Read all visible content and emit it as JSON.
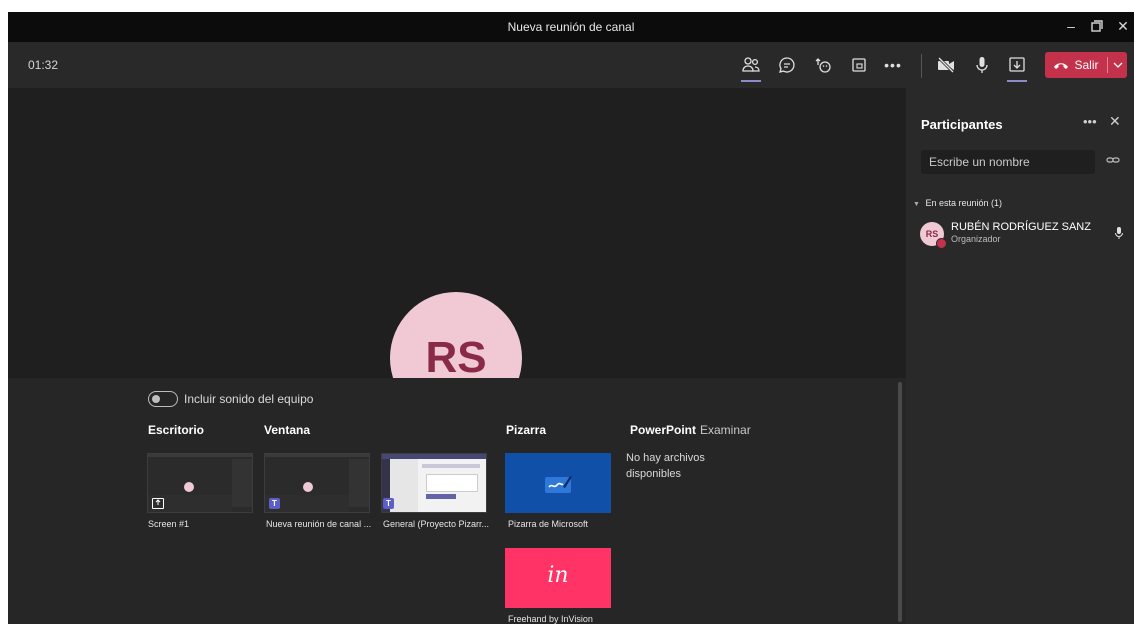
{
  "window": {
    "title": "Nueva reunión de canal"
  },
  "toolbar": {
    "timer": "01:32",
    "leave_label": "Salir"
  },
  "share_tray": {
    "include_sound_label": "Incluir sonido del equipo",
    "headers": {
      "desktop": "Escritorio",
      "window": "Ventana",
      "whiteboard": "Pizarra",
      "powerpoint": "PowerPoint",
      "browse": "Examinar"
    },
    "thumbnails": [
      {
        "label": "Screen #1"
      },
      {
        "label": "Nueva reunión de canal ..."
      },
      {
        "label": "General (Proyecto Pizarr..."
      },
      {
        "label": "Pizarra de Microsoft"
      },
      {
        "label": "Freehand by InVision"
      }
    ],
    "no_files": "No hay archivos disponibles",
    "invision_logo": "in"
  },
  "stage": {
    "avatar_initials": "RS"
  },
  "participants": {
    "title": "Participantes",
    "search_placeholder": "Escribe un nombre",
    "section_label": "En esta reunión (1)",
    "people": [
      {
        "initials": "RS",
        "name": "RUBÉN RODRÍGUEZ SANZ",
        "role": "Organizador"
      }
    ]
  },
  "colors": {
    "accent": "#8b8cc7",
    "leave": "#c4314b",
    "whiteboard_bg": "#1150a8",
    "invision_bg": "#ff3366"
  }
}
